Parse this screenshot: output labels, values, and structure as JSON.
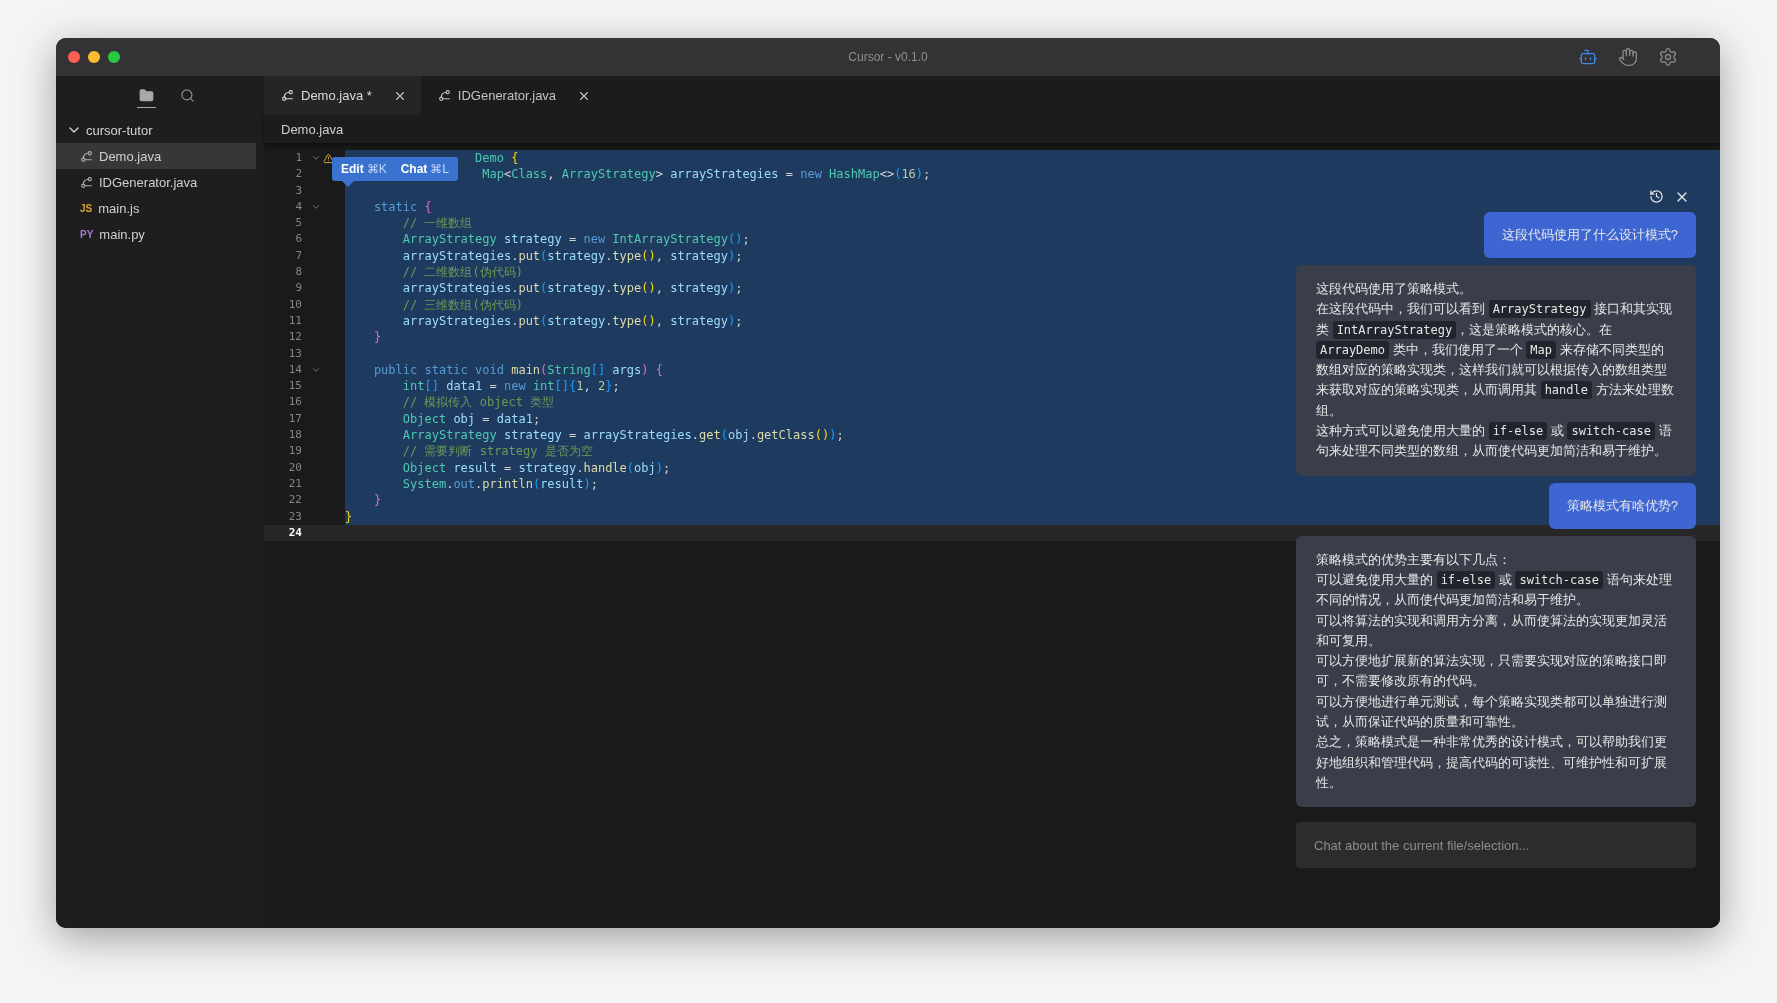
{
  "window": {
    "title": "Cursor - v0.1.0"
  },
  "toolbar_icons": [
    {
      "kind": "robot",
      "active": true
    },
    {
      "kind": "hand",
      "active": false
    },
    {
      "kind": "settings",
      "active": false
    }
  ],
  "activity": [
    {
      "kind": "files",
      "selected": true
    },
    {
      "kind": "search",
      "selected": false
    }
  ],
  "tree": {
    "label": "cursor-tutor",
    "expanded": true,
    "children": [
      {
        "label": "Demo.java",
        "kind": "branch",
        "selected": true
      },
      {
        "label": "IDGenerator.java",
        "kind": "branch",
        "selected": false
      },
      {
        "label": "main.js",
        "kind": "badge",
        "badge": "JS",
        "color": "#d6a43a",
        "selected": false
      },
      {
        "label": "main.py",
        "kind": "badge",
        "badge": "PY",
        "color": "#a77bd6",
        "selected": false
      }
    ]
  },
  "tabs": [
    {
      "label": "Demo.java *",
      "selected": true
    },
    {
      "label": "IDGenerator.java",
      "selected": false
    }
  ],
  "breadcrumb": "Demo.java",
  "popup": [
    {
      "label": "Edit",
      "shortcut": "⌘K"
    },
    {
      "label": "Chat",
      "shortcut": "⌘L"
    }
  ],
  "lines": [
    {
      "n": "1",
      "fold": true,
      "warning": true,
      "selected": true,
      "current": false,
      "tokens": [
        {
          "t": "                  Demo",
          "kind": "type"
        },
        {
          "t": " {",
          "kind": "b1"
        }
      ]
    },
    {
      "n": "2",
      "fold": false,
      "warning": false,
      "selected": true,
      "current": false,
      "tokens": [
        {
          "t": "                   Map",
          "kind": "type"
        },
        {
          "t": "<",
          "kind": "punc"
        },
        {
          "t": "Class",
          "kind": "type"
        },
        {
          "t": ", ",
          "kind": "punc"
        },
        {
          "t": "ArrayStrategy",
          "kind": "type"
        },
        {
          "t": "> ",
          "kind": "punc"
        },
        {
          "t": "arrayStrategies",
          "kind": "var"
        },
        {
          "t": " = ",
          "kind": "punc"
        },
        {
          "t": "new",
          "kind": "kw"
        },
        {
          "t": " HashMap",
          "kind": "type"
        },
        {
          "t": "<>",
          "kind": "punc"
        },
        {
          "t": "(",
          "kind": "b3"
        },
        {
          "t": "16",
          "kind": "num"
        },
        {
          "t": ")",
          "kind": "b3"
        },
        {
          "t": ";",
          "kind": "punc"
        }
      ]
    },
    {
      "n": "3",
      "fold": false,
      "warning": false,
      "selected": true,
      "current": false
    },
    {
      "n": "4",
      "fold": true,
      "warning": false,
      "selected": true,
      "current": false,
      "tokens": [
        {
          "t": "    static",
          "kind": "kw"
        },
        {
          "t": " {",
          "kind": "b2"
        }
      ]
    },
    {
      "n": "5",
      "fold": false,
      "warning": false,
      "selected": true,
      "current": false,
      "tokens": [
        {
          "t": "        // 一维数组",
          "kind": "cmt"
        }
      ]
    },
    {
      "n": "6",
      "fold": false,
      "warning": false,
      "selected": true,
      "current": false,
      "tokens": [
        {
          "t": "        ArrayStrategy",
          "kind": "type"
        },
        {
          "t": " strategy",
          "kind": "var"
        },
        {
          "t": " = ",
          "kind": "punc"
        },
        {
          "t": "new",
          "kind": "kw"
        },
        {
          "t": " IntArrayStrategy",
          "kind": "type"
        },
        {
          "t": "()",
          "kind": "b3"
        },
        {
          "t": ";",
          "kind": "punc"
        }
      ]
    },
    {
      "n": "7",
      "fold": false,
      "warning": false,
      "selected": true,
      "current": false,
      "tokens": [
        {
          "t": "        arrayStrategies",
          "kind": "var"
        },
        {
          "t": ".",
          "kind": "punc"
        },
        {
          "t": "put",
          "kind": "fn"
        },
        {
          "t": "(",
          "kind": "b3"
        },
        {
          "t": "strategy",
          "kind": "var"
        },
        {
          "t": ".",
          "kind": "punc"
        },
        {
          "t": "type",
          "kind": "fn"
        },
        {
          "t": "()",
          "kind": "b1"
        },
        {
          "t": ", ",
          "kind": "punc"
        },
        {
          "t": "strategy",
          "kind": "var"
        },
        {
          "t": ")",
          "kind": "b3"
        },
        {
          "t": ";",
          "kind": "punc"
        }
      ]
    },
    {
      "n": "8",
      "fold": false,
      "warning": false,
      "selected": true,
      "current": false,
      "tokens": [
        {
          "t": "        // 二维数组(伪代码)",
          "kind": "cmt"
        }
      ]
    },
    {
      "n": "9",
      "fold": false,
      "warning": false,
      "selected": true,
      "current": false,
      "tokens": [
        {
          "t": "        arrayStrategies",
          "kind": "var"
        },
        {
          "t": ".",
          "kind": "punc"
        },
        {
          "t": "put",
          "kind": "fn"
        },
        {
          "t": "(",
          "kind": "b3"
        },
        {
          "t": "strategy",
          "kind": "var"
        },
        {
          "t": ".",
          "kind": "punc"
        },
        {
          "t": "type",
          "kind": "fn"
        },
        {
          "t": "()",
          "kind": "b1"
        },
        {
          "t": ", ",
          "kind": "punc"
        },
        {
          "t": "strategy",
          "kind": "var"
        },
        {
          "t": ")",
          "kind": "b3"
        },
        {
          "t": ";",
          "kind": "punc"
        }
      ]
    },
    {
      "n": "10",
      "fold": false,
      "warning": false,
      "selected": true,
      "current": false,
      "tokens": [
        {
          "t": "        // 三维数组(伪代码)",
          "kind": "cmt"
        }
      ]
    },
    {
      "n": "11",
      "fold": false,
      "warning": false,
      "selected": true,
      "current": false,
      "tokens": [
        {
          "t": "        arrayStrategies",
          "kind": "var"
        },
        {
          "t": ".",
          "kind": "punc"
        },
        {
          "t": "put",
          "kind": "fn"
        },
        {
          "t": "(",
          "kind": "b3"
        },
        {
          "t": "strategy",
          "kind": "var"
        },
        {
          "t": ".",
          "kind": "punc"
        },
        {
          "t": "type",
          "kind": "fn"
        },
        {
          "t": "()",
          "kind": "b1"
        },
        {
          "t": ", ",
          "kind": "punc"
        },
        {
          "t": "strategy",
          "kind": "var"
        },
        {
          "t": ")",
          "kind": "b3"
        },
        {
          "t": ";",
          "kind": "punc"
        }
      ]
    },
    {
      "n": "12",
      "fold": false,
      "warning": false,
      "selected": true,
      "current": false,
      "tokens": [
        {
          "t": "    }",
          "kind": "b2"
        }
      ]
    },
    {
      "n": "13",
      "fold": false,
      "warning": false,
      "selected": true,
      "current": false
    },
    {
      "n": "14",
      "fold": true,
      "warning": false,
      "selected": true,
      "current": false,
      "tokens": [
        {
          "t": "    public static void",
          "kind": "kw"
        },
        {
          "t": " main",
          "kind": "fn"
        },
        {
          "t": "(",
          "kind": "b2"
        },
        {
          "t": "String",
          "kind": "type"
        },
        {
          "t": "[]",
          "kind": "b3"
        },
        {
          "t": " args",
          "kind": "var"
        },
        {
          "t": ")",
          "kind": "b2"
        },
        {
          "t": " {",
          "kind": "b2"
        }
      ]
    },
    {
      "n": "15",
      "fold": false,
      "warning": false,
      "selected": true,
      "current": false,
      "tokens": [
        {
          "t": "        int",
          "kind": "type"
        },
        {
          "t": "[]",
          "kind": "b3"
        },
        {
          "t": " data1",
          "kind": "var"
        },
        {
          "t": " = ",
          "kind": "punc"
        },
        {
          "t": "new",
          "kind": "kw"
        },
        {
          "t": " int",
          "kind": "type"
        },
        {
          "t": "[]",
          "kind": "b3"
        },
        {
          "t": "{",
          "kind": "b3"
        },
        {
          "t": "1",
          "kind": "num"
        },
        {
          "t": ", ",
          "kind": "punc"
        },
        {
          "t": "2",
          "kind": "num"
        },
        {
          "t": "}",
          "kind": "b3"
        },
        {
          "t": ";",
          "kind": "punc"
        }
      ]
    },
    {
      "n": "16",
      "fold": false,
      "warning": false,
      "selected": true,
      "current": false,
      "tokens": [
        {
          "t": "        // 模拟传入 object 类型",
          "kind": "cmt"
        }
      ]
    },
    {
      "n": "17",
      "fold": false,
      "warning": false,
      "selected": true,
      "current": false,
      "tokens": [
        {
          "t": "        Object",
          "kind": "type"
        },
        {
          "t": " obj",
          "kind": "var"
        },
        {
          "t": " = ",
          "kind": "punc"
        },
        {
          "t": "data1",
          "kind": "var"
        },
        {
          "t": ";",
          "kind": "punc"
        }
      ]
    },
    {
      "n": "18",
      "fold": false,
      "warning": false,
      "selected": true,
      "current": false,
      "tokens": [
        {
          "t": "        ArrayStrategy",
          "kind": "type"
        },
        {
          "t": " strategy",
          "kind": "var"
        },
        {
          "t": " = ",
          "kind": "punc"
        },
        {
          "t": "arrayStrategies",
          "kind": "var"
        },
        {
          "t": ".",
          "kind": "punc"
        },
        {
          "t": "get",
          "kind": "fn"
        },
        {
          "t": "(",
          "kind": "b3"
        },
        {
          "t": "obj",
          "kind": "var"
        },
        {
          "t": ".",
          "kind": "punc"
        },
        {
          "t": "getClass",
          "kind": "fn"
        },
        {
          "t": "()",
          "kind": "b1"
        },
        {
          "t": ")",
          "kind": "b3"
        },
        {
          "t": ";",
          "kind": "punc"
        }
      ]
    },
    {
      "n": "19",
      "fold": false,
      "warning": false,
      "selected": true,
      "current": false,
      "tokens": [
        {
          "t": "        // 需要判断 strategy 是否为空",
          "kind": "cmt"
        }
      ]
    },
    {
      "n": "20",
      "fold": false,
      "warning": false,
      "selected": true,
      "current": false,
      "tokens": [
        {
          "t": "        Object",
          "kind": "type"
        },
        {
          "t": " result",
          "kind": "var"
        },
        {
          "t": " = ",
          "kind": "punc"
        },
        {
          "t": "strategy",
          "kind": "var"
        },
        {
          "t": ".",
          "kind": "punc"
        },
        {
          "t": "handle",
          "kind": "fn"
        },
        {
          "t": "(",
          "kind": "b3"
        },
        {
          "t": "obj",
          "kind": "var"
        },
        {
          "t": ")",
          "kind": "b3"
        },
        {
          "t": ";",
          "kind": "punc"
        }
      ]
    },
    {
      "n": "21",
      "fold": false,
      "warning": false,
      "selected": true,
      "current": false,
      "tokens": [
        {
          "t": "        System",
          "kind": "type"
        },
        {
          "t": ".",
          "kind": "punc"
        },
        {
          "t": "out",
          "kind": "kw"
        },
        {
          "t": ".",
          "kind": "punc"
        },
        {
          "t": "println",
          "kind": "fn"
        },
        {
          "t": "(",
          "kind": "b3"
        },
        {
          "t": "result",
          "kind": "var"
        },
        {
          "t": ")",
          "kind": "b3"
        },
        {
          "t": ";",
          "kind": "punc"
        }
      ]
    },
    {
      "n": "22",
      "fold": false,
      "warning": false,
      "selected": true,
      "current": false,
      "tokens": [
        {
          "t": "    }",
          "kind": "b2"
        }
      ]
    },
    {
      "n": "23",
      "fold": false,
      "warning": false,
      "selected": true,
      "current": false,
      "tokens": [
        {
          "t": "}",
          "kind": "b1"
        }
      ]
    },
    {
      "n": "24",
      "fold": false,
      "warning": false,
      "selected": false,
      "current": true
    }
  ],
  "chat": {
    "messages": [
      {
        "kind": "user",
        "paragraphs": [
          [
            {
              "t": "这段代码使用了什么设计模式?"
            }
          ]
        ]
      },
      {
        "kind": "assistant",
        "paragraphs": [
          [
            {
              "t": "这段代码使用了策略模式。"
            }
          ],
          [
            {
              "t": "在这段代码中，我们可以看到 "
            },
            {
              "t": "ArrayStrategy",
              "code": true
            },
            {
              "t": " 接口和其实现类 "
            },
            {
              "t": "IntArrayStrategy",
              "code": true
            },
            {
              "t": "，这是策略模式的核心。在 "
            },
            {
              "t": "ArrayDemo",
              "code": true
            },
            {
              "t": " 类中，我们使用了一个 "
            },
            {
              "t": "Map",
              "code": true
            },
            {
              "t": " 来存储不同类型的数组对应的策略实现类，这样我们就可以根据传入的数组类型来获取对应的策略实现类，从而调用其 "
            },
            {
              "t": "handle",
              "code": true
            },
            {
              "t": " 方法来处理数组。"
            }
          ],
          [
            {
              "t": "这种方式可以避免使用大量的 "
            },
            {
              "t": "if-else",
              "code": true
            },
            {
              "t": " 或 "
            },
            {
              "t": "switch-case",
              "code": true
            },
            {
              "t": " 语句来处理不同类型的数组，从而使代码更加简洁和易于维护。"
            }
          ]
        ]
      },
      {
        "kind": "user",
        "paragraphs": [
          [
            {
              "t": "策略模式有啥优势?"
            }
          ]
        ]
      },
      {
        "kind": "assistant",
        "paragraphs": [
          [
            {
              "t": "策略模式的优势主要有以下几点："
            }
          ],
          [
            {
              "t": "可以避免使用大量的 "
            },
            {
              "t": "if-else",
              "code": true
            },
            {
              "t": " 或 "
            },
            {
              "t": "switch-case",
              "code": true
            },
            {
              "t": " 语句来处理不同的情况，从而使代码更加简洁和易于维护。"
            }
          ],
          [
            {
              "t": "可以将算法的实现和调用方分离，从而使算法的实现更加灵活和可复用。"
            }
          ],
          [
            {
              "t": "可以方便地扩展新的算法实现，只需要实现对应的策略接口即可，不需要修改原有的代码。"
            }
          ],
          [
            {
              "t": "可以方便地进行单元测试，每个策略实现类都可以单独进行测试，从而保证代码的质量和可靠性。"
            }
          ],
          [
            {
              "t": "总之，策略模式是一种非常优秀的设计模式，可以帮助我们更好地组织和管理代码，提高代码的可读性、可维护性和可扩展性。"
            }
          ]
        ]
      }
    ],
    "input": {
      "placeholder": "Chat about the current file/selection..."
    }
  }
}
